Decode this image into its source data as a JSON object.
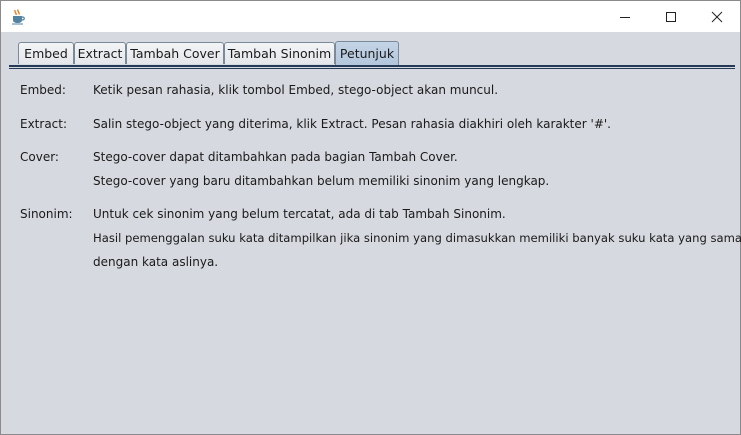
{
  "window": {
    "icon": "java-coffee-cup-icon",
    "controls": [
      "minimize-icon",
      "maximize-icon",
      "close-icon"
    ]
  },
  "tabs": [
    {
      "label": "Embed",
      "active": false
    },
    {
      "label": "Extract",
      "active": false
    },
    {
      "label": "Tambah Cover",
      "active": false
    },
    {
      "label": "Tambah Sinonim",
      "active": false
    },
    {
      "label": "Petunjuk",
      "active": true
    }
  ],
  "instructions": {
    "embed": {
      "label": "Embed:",
      "lines": [
        "Ketik pesan rahasia, klik tombol Embed, stego-object akan muncul."
      ]
    },
    "extract": {
      "label": "Extract:",
      "lines": [
        "Salin stego-object yang diterima, klik Extract. Pesan rahasia diakhiri oleh karakter '#'."
      ]
    },
    "cover": {
      "label": "Cover:",
      "lines": [
        "Stego-cover dapat ditambahkan pada bagian Tambah Cover.",
        "Stego-cover yang baru ditambahkan belum memiliki sinonim yang lengkap."
      ]
    },
    "sinonim": {
      "label": "Sinonim:",
      "lines": [
        "Untuk cek sinonim yang belum tercatat, ada di tab Tambah Sinonim.",
        "Hasil pemenggalan suku kata ditampilkan jika sinonim yang dimasukkan memiliki banyak suku kata yang sama",
        "dengan kata aslinya."
      ]
    }
  },
  "colors": {
    "background": "#d6d9df",
    "active_tab": "#b8cadf",
    "tab_border": "#7a8a99",
    "divider": "#253a57"
  }
}
